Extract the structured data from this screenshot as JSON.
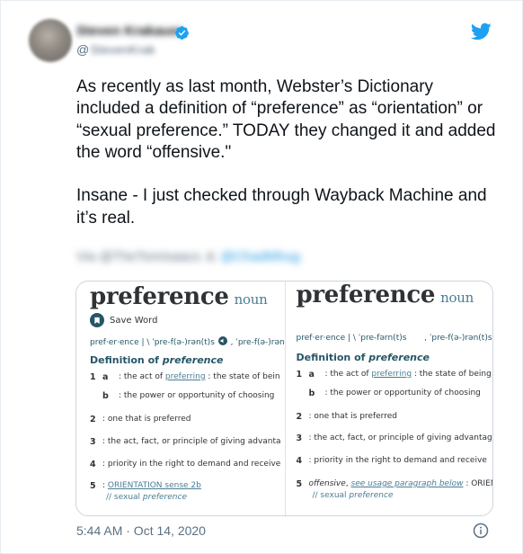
{
  "tweet": {
    "display_name": "Steven Krakauer",
    "handle_at": "@",
    "handle": "StevenKrak",
    "text": "As recently as last month, Webster’s Dictionary included a definition of “preference” as “orientation” or “sexual preference.” TODAY they changed it and added the word “offensive.\"\n\nInsane - I just checked through Wayback Machine and it’s real.",
    "blurred_meta_1": "Via @TheTomIsaacs",
    "blurred_meta_2": "&",
    "blurred_meta_3": "@ChadMhug",
    "timestamp": "5:44 AM · Oct 14, 2020"
  },
  "icons": {
    "verified": "verified-badge-icon",
    "brand": "twitter-bird-icon",
    "info": "info-icon",
    "save": "bookmark-icon",
    "audio": "speaker-icon"
  },
  "colors": {
    "twitter_blue": "#1da1f2",
    "secondary_text": "#5b7083",
    "dictionary_teal": "#265667",
    "dictionary_link": "#4a7d95"
  },
  "dictionary_left": {
    "word": "preference",
    "pos": "noun",
    "save_label": "Save Word",
    "pronunciation_a": "pref·er·ence  |  \\ ˈpre-f(ə-)rən(t)s",
    "pronunciation_b": ", ˈpre-f(ə-)rən(t)",
    "definition_heading_prefix": "Definition of ",
    "definition_heading_word": "preference",
    "s1_num": "1",
    "s1a_letter": "a",
    "s1a_pre": ": the act of ",
    "s1a_link": "preferring",
    "s1a_post": " : the state of bein",
    "s1b_letter": "b",
    "s1b_text": ": the power or opportunity of choosing",
    "s2_num": "2",
    "s2_text": ": one that is preferred",
    "s3_num": "3",
    "s3_text": ": the act, fact, or principle of giving advanta",
    "s4_num": "4",
    "s4_text": ": priority in the right to demand and receive",
    "s5_num": "5",
    "s5_pre": ": ",
    "s5_link": "ORIENTATION sense 2b",
    "s5_usage_prefix": "// sexual ",
    "s5_usage_word": "preference"
  },
  "dictionary_right": {
    "word": "preference",
    "pos": "noun",
    "pronunciation_a": "pref·er·ence  |  \\ ˈpre-fərn(t)s",
    "pronunciation_b": ", ˈpre-f(ə-)rən(t)s",
    "definition_heading_prefix": "Definition of ",
    "definition_heading_word": "preference",
    "s1_num": "1",
    "s1a_letter": "a",
    "s1a_pre": ": the act of ",
    "s1a_link": "preferring",
    "s1a_post": " : the state of being",
    "s1b_letter": "b",
    "s1b_text": ": the power or opportunity of choosing",
    "s2_num": "2",
    "s2_text": ": one that is preferred",
    "s3_num": "3",
    "s3_text": ": the act, fact, or principle of giving advantag",
    "s4_num": "4",
    "s4_text": ": priority in the right to demand and receive",
    "s5_num": "5",
    "s5_offensive": "offensive",
    "s5_comma": ", ",
    "s5_usage_link": "see usage paragraph below",
    "s5_post": " : ORIENT",
    "s5_usage_prefix": "// sexual ",
    "s5_usage_word": "preference"
  }
}
